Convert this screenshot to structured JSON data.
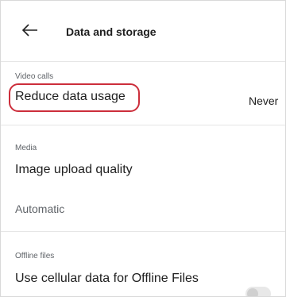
{
  "header": {
    "title": "Data and storage",
    "back_icon": "arrow-left-icon"
  },
  "sections": {
    "video_calls": {
      "caption": "Video calls",
      "reduce_data_usage": {
        "label": "Reduce data usage",
        "value": "Never"
      }
    },
    "media": {
      "caption": "Media",
      "image_upload_quality": {
        "label": "Image upload quality",
        "value": "Automatic"
      }
    },
    "offline_files": {
      "caption": "Offline files",
      "use_cellular": {
        "label": "Use cellular data for Offline Files",
        "toggle": "off"
      }
    }
  },
  "colors": {
    "highlight": "#cc2e3b"
  }
}
